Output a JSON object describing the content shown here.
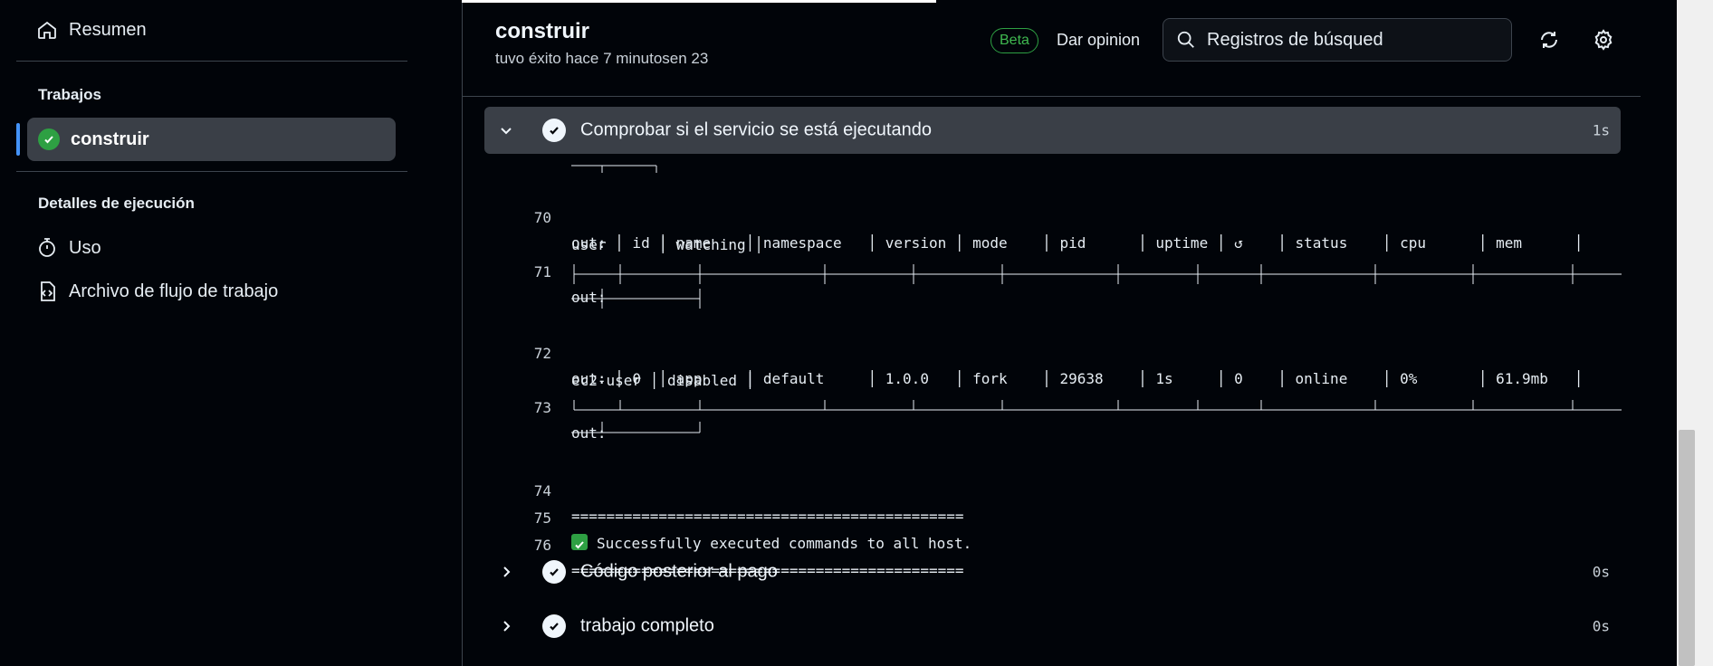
{
  "sidebar": {
    "summary": "Resumen",
    "jobs_title": "Trabajos",
    "job_active": "construir",
    "run_details_title": "Detalles de ejecución",
    "usage": "Uso",
    "workflow_file": "Archivo de flujo de trabajo"
  },
  "header": {
    "title": "construir",
    "subtitle": "tuvo éxito hace 7 minutosen 23",
    "beta": "Beta",
    "feedback": "Dar opinion",
    "search_placeholder": "Registros de búsqued"
  },
  "step_open": {
    "label": "Comprobar si el servicio se está ejecutando",
    "time": "1s"
  },
  "log": {
    "l70": "70",
    "l70a": "out: │ id │ name    │ namespace   │ version │ mode    │ pid      │ uptime │ ↺    │ status    │ cpu      │ mem      │",
    "l70b": "user      │ watching │",
    "l71": "71",
    "l71a": "out:",
    "l72": "72",
    "l72a": "out: │ 0  │ app     │ default     │ 1.0.0   │ fork    │ 29638    │ 1s     │ 0    │ online    │ 0%       │ 61.9mb   │",
    "l72b": "ec2-user │ disabled │",
    "l73": "73",
    "l73a": "out:",
    "l74": "74",
    "l74a": "=============================================",
    "l75": "75",
    "l75a": "Successfully executed commands to all host.",
    "l76": "76",
    "l76a": "============================================="
  },
  "steps": [
    {
      "label": "Código posterior al pago",
      "time": "0s"
    },
    {
      "label": "trabajo completo",
      "time": "0s"
    }
  ],
  "colors": {
    "accent": "#4493f8",
    "success": "#2ea043",
    "selected_bg": "#3a3f47"
  }
}
